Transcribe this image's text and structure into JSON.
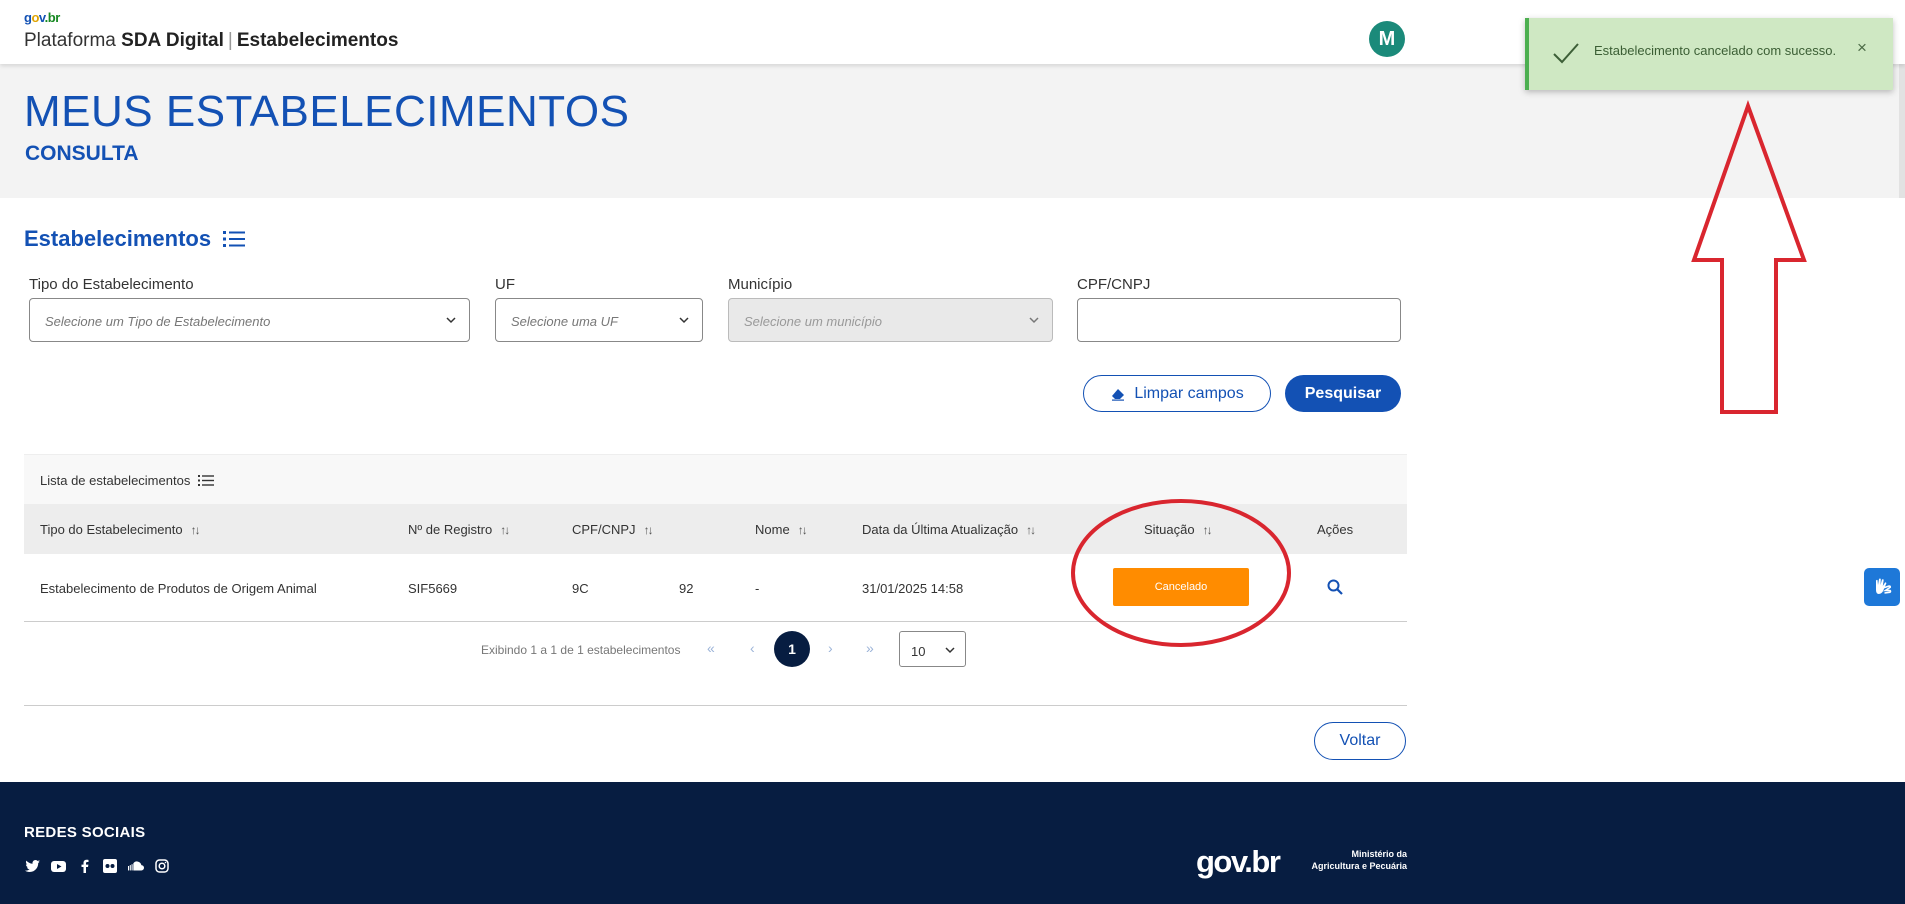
{
  "header": {
    "logo_text": {
      "g": "g",
      "o": "o",
      "v": "v",
      "b": ".br"
    },
    "platform_label": "Plataforma",
    "platform_name": "SDA Digital",
    "separator": "|",
    "module_name": "Estabelecimentos",
    "avatar_initial": "M",
    "avatar_color": "#1b8a7a"
  },
  "toast": {
    "message": "Estabelecimento cancelado com sucesso.",
    "close_symbol": "×",
    "icon": "check-icon",
    "color": "#cfe8c3"
  },
  "banner": {
    "title": "MEUS ESTABELECIMENTOS",
    "subtitle": "CONSULTA"
  },
  "section": {
    "title": "Estabelecimentos",
    "icon": "list-icon"
  },
  "filters": {
    "tipo": {
      "label": "Tipo do Estabelecimento",
      "placeholder": "Selecione um Tipo de Estabelecimento"
    },
    "uf": {
      "label": "UF",
      "placeholder": "Selecione uma UF"
    },
    "municipio": {
      "label": "Município",
      "placeholder": "Selecione um município",
      "disabled": true
    },
    "cpf": {
      "label": "CPF/CNPJ",
      "value": ""
    }
  },
  "actions": {
    "clear_label": "Limpar campos",
    "search_label": "Pesquisar",
    "back_label": "Voltar"
  },
  "table": {
    "caption": "Lista de estabelecimentos",
    "sort_symbol": "↑↓",
    "columns": [
      "Tipo do Estabelecimento",
      "Nº de Registro",
      "CPF/CNPJ",
      "Nome",
      "Data da Última Atualização",
      "Situação",
      "Ações"
    ],
    "rows": [
      {
        "tipo": "Estabelecimento de Produtos de Origem Animal",
        "registro": "SIF5669",
        "cpf_a": "9C",
        "cpf_b": "92",
        "nome": "-",
        "data": "31/01/2025 14:58",
        "situacao": "Cancelado",
        "acao_icon": "search-icon"
      }
    ]
  },
  "pagination": {
    "info": "Exibindo 1 a 1 de 1 estabelecimentos",
    "first": "«",
    "prev": "‹",
    "current": "1",
    "next": "›",
    "last": "»",
    "page_size": "10"
  },
  "footer": {
    "social_title": "REDES SOCIAIS",
    "social_icons": [
      "twitter-icon",
      "youtube-icon",
      "facebook-icon",
      "flickr-icon",
      "soundcloud-icon",
      "instagram-icon"
    ],
    "gov_logo": "gov.br",
    "ministerio_line1": "Ministério da",
    "ministerio_line2": "Agricultura e Pecuária"
  },
  "colors": {
    "primary": "#1351b4",
    "footer_bg": "#071d41",
    "status_cancelado": "#ff8c00",
    "annotation_red": "#d9262f"
  }
}
